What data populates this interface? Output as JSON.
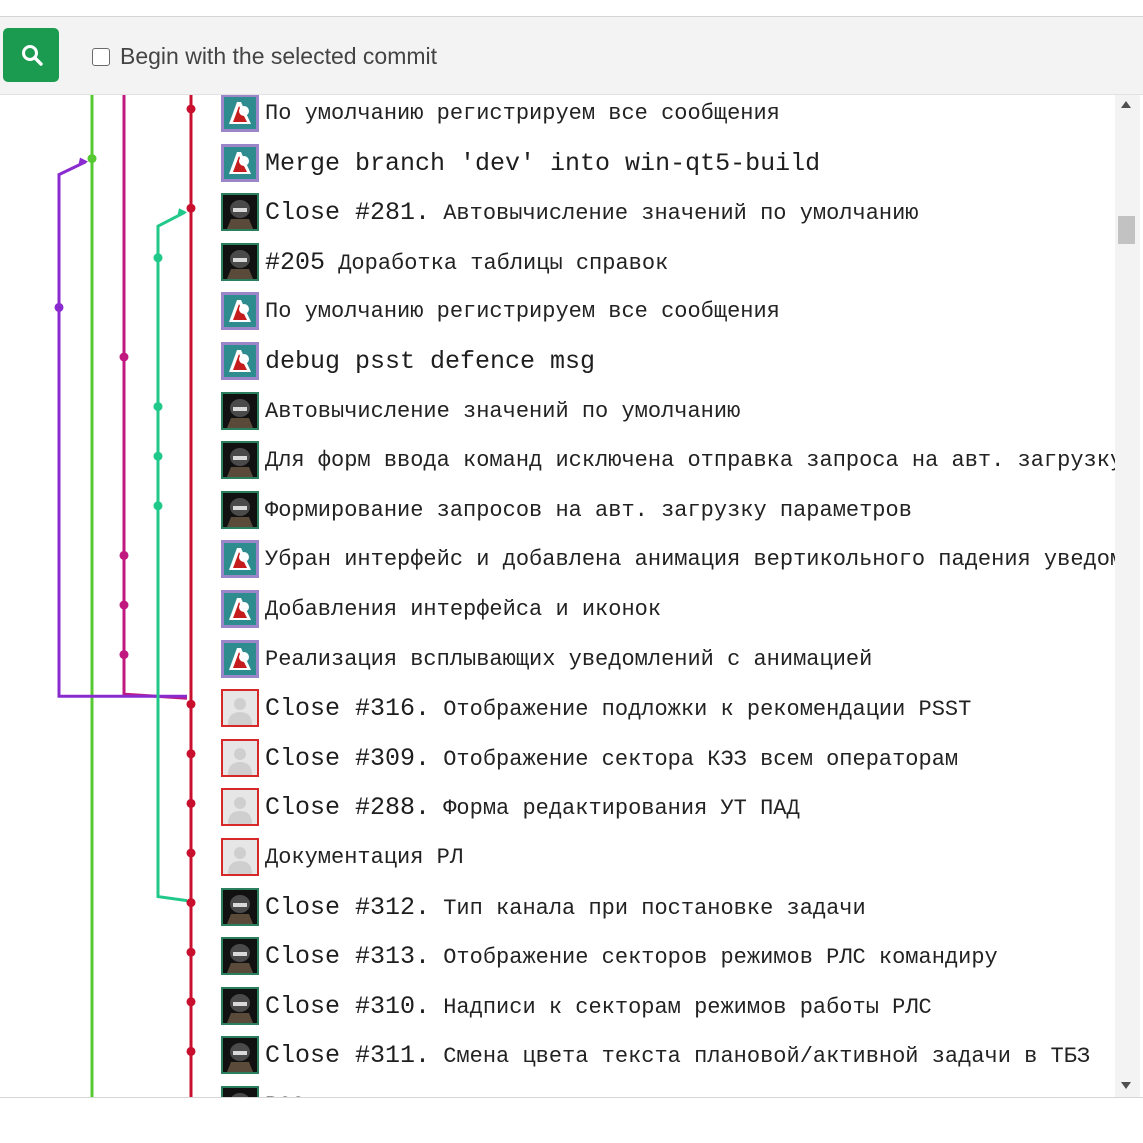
{
  "toolbar": {
    "search_icon": "search-icon",
    "accent_color": "#1a9b50",
    "begin_label": "Begin with the selected commit",
    "begin_checked": false
  },
  "graph_colors": {
    "main": "#c8102e",
    "green": "#55c832",
    "magenta": "#c0187f",
    "purple": "#8a2bd0",
    "teal": "#20c98a"
  },
  "commits": [
    {
      "avatar": "helmet-avatar",
      "prefix": "",
      "text": "По умолчанию регистрируем все сообщения"
    },
    {
      "avatar": "helmet-avatar",
      "prefix": "",
      "text": "Merge branch 'dev' into win-qt5-build"
    },
    {
      "avatar": "soldier-avatar",
      "prefix": "Close #281.",
      "text": " Автовычисление значений по умолчанию"
    },
    {
      "avatar": "soldier-avatar",
      "prefix": "#205",
      "text": " Доработка таблицы справок"
    },
    {
      "avatar": "helmet-avatar",
      "prefix": "",
      "text": "По умолчанию регистрируем все сообщения"
    },
    {
      "avatar": "helmet-avatar",
      "prefix": "",
      "text": "debug psst defence msg"
    },
    {
      "avatar": "soldier-avatar",
      "prefix": "",
      "text": "Автовычисление значений по умолчанию"
    },
    {
      "avatar": "soldier-avatar",
      "prefix": "",
      "text": "Для форм ввода команд исключена отправка запроса на авт. загрузку"
    },
    {
      "avatar": "soldier-avatar",
      "prefix": "",
      "text": "Формирование запросов на авт. загрузку параметров"
    },
    {
      "avatar": "helmet-avatar",
      "prefix": "",
      "text": "Убран интерфейс и добавлена анимация вертикольного падения уведомле"
    },
    {
      "avatar": "helmet-avatar",
      "prefix": "",
      "text": "Добавления интерфейса и иконок"
    },
    {
      "avatar": "helmet-avatar",
      "prefix": "",
      "text": "Реализация всплывающих уведомлений с анимацией"
    },
    {
      "avatar": "default-avatar",
      "prefix": "Close #316.",
      "text": " Отображение подложки к рекомендации PSST"
    },
    {
      "avatar": "default-avatar",
      "prefix": "Close #309.",
      "text": " Отображение сектора КЭЗ всем операторам"
    },
    {
      "avatar": "default-avatar",
      "prefix": "Close #288.",
      "text": " Форма редактирования УТ ПАД"
    },
    {
      "avatar": "default-avatar",
      "prefix": "",
      "text": "Документация РЛ"
    },
    {
      "avatar": "soldier-avatar",
      "prefix": "Close #312.",
      "text": " Тип канала при постановке задачи"
    },
    {
      "avatar": "soldier-avatar",
      "prefix": "Close #313.",
      "text": " Отображение секторов режимов РЛС командиру"
    },
    {
      "avatar": "soldier-avatar",
      "prefix": "Close #310.",
      "text": " Надписи к секторам режимов работы РЛС"
    },
    {
      "avatar": "soldier-avatar",
      "prefix": "Close #311.",
      "text": " Смена цвета текста плановой/активной задачи в ТБЗ"
    },
    {
      "avatar": "soldier-avatar",
      "prefix": "",
      "text": "РСС"
    }
  ]
}
